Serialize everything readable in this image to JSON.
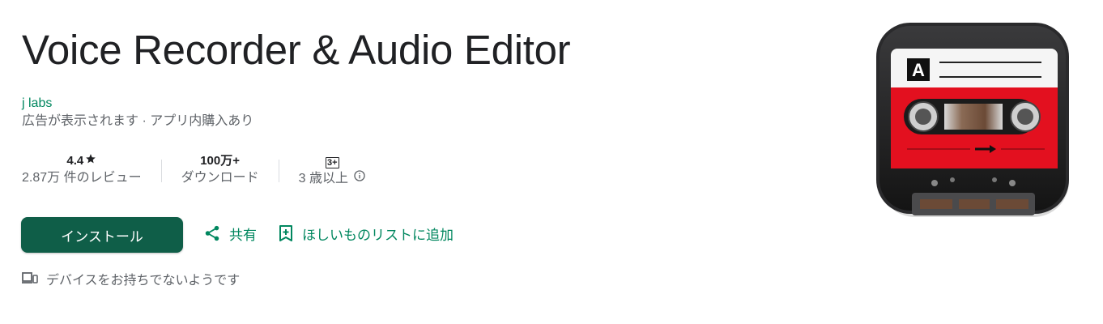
{
  "app": {
    "title": "Voice Recorder & Audio Editor",
    "developer": "j labs",
    "monetization": "広告が表示されます · アプリ内購入あり"
  },
  "stats": {
    "rating": {
      "value": "4.4",
      "label": "2.87万 件のレビュー",
      "icon": "star-icon"
    },
    "downloads": {
      "value": "100万+",
      "label": "ダウンロード"
    },
    "age": {
      "badge": "3+",
      "label": "3 歳以上",
      "icon": "info-icon"
    }
  },
  "actions": {
    "install_label": "インストール",
    "share_label": "共有",
    "wishlist_label": "ほしいものリストに追加"
  },
  "device_note": "デバイスをお持ちでないようです",
  "icon_art": {
    "cassette_letter": "A",
    "cassette_red": "#e3101f",
    "body_dark": "#1c1c1e"
  },
  "colors": {
    "accent": "#01875f",
    "install_bg": "#0f5e48"
  }
}
